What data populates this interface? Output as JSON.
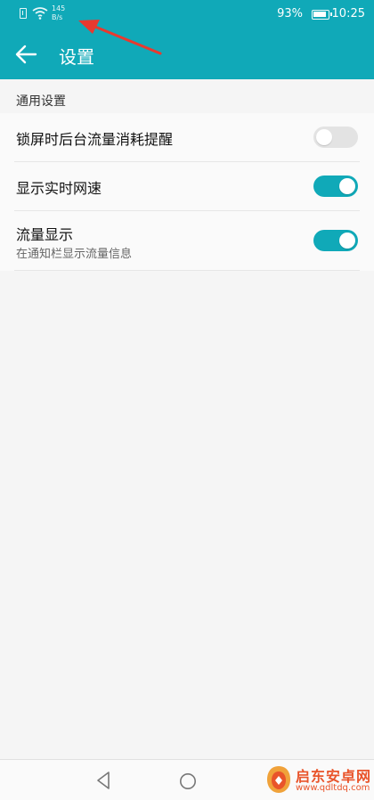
{
  "status_bar": {
    "net_speed_value": "145",
    "net_speed_unit": "B/s",
    "battery_percent": "93%",
    "time": "10:25"
  },
  "header": {
    "title": "设置"
  },
  "section": {
    "title": "通用设置"
  },
  "items": [
    {
      "title": "锁屏时后台流量消耗提醒",
      "toggle": "off"
    },
    {
      "title": "显示实时网速",
      "toggle": "on"
    },
    {
      "title": "流量显示",
      "subtitle": "在通知栏显示流量信息",
      "toggle": "on"
    }
  ],
  "watermark": {
    "title": "启东安卓网",
    "url": "www.qdltdq.com"
  },
  "colors": {
    "accent": "#10a9b8",
    "annotation_arrow": "#e8392f",
    "watermark": "#e9542a"
  }
}
